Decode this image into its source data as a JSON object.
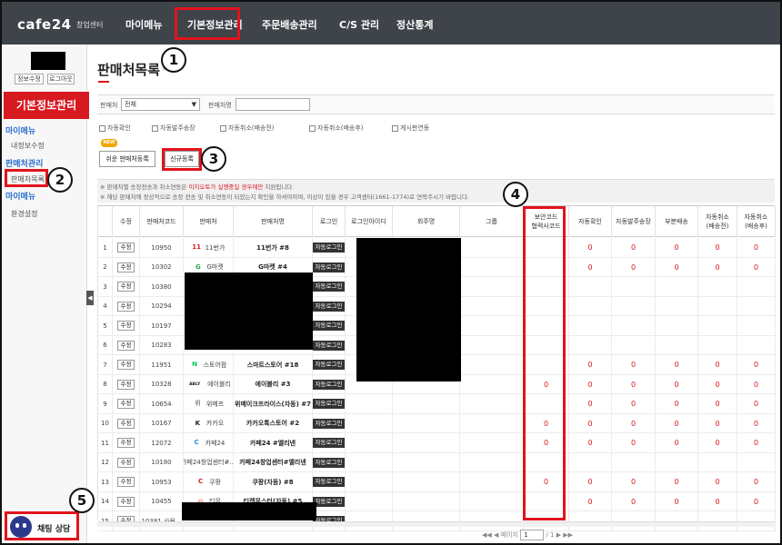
{
  "brand": {
    "logo": "cafe24",
    "sub": "창업센터"
  },
  "nav": [
    "마이메뉴",
    "기본정보관리",
    "주문배송관리",
    "C/S 관리",
    "정산통계"
  ],
  "callouts": [
    "1",
    "2",
    "3",
    "4",
    "5"
  ],
  "sidebar": {
    "buttons": [
      "정보수정",
      "로그아웃"
    ],
    "section_title": "기본정보관리",
    "head1": "마이메뉴",
    "item1": "내정보수정",
    "head2": "판매처관리",
    "item2": "판매처목록",
    "head3": "마이메뉴",
    "item3": "환경설정",
    "toggle": "◀",
    "chat_label": "채팅 상담"
  },
  "page": {
    "title": "판매처목록",
    "title_icon": "★"
  },
  "filter": {
    "label1": "판매처",
    "select1": "전체",
    "label2": "판매처명",
    "input2": ""
  },
  "checkboxes": [
    "자동확인",
    "자동발주송장",
    "자동취소(배송전)",
    "자동취소(배송후)",
    "게시판연동"
  ],
  "new_tag": "NEW",
  "buttons": {
    "easy": "쉬운 판매처등록",
    "new": "신규등록"
  },
  "notes": {
    "n1_pre": "※ 판매처별 송장전송과 취소연동은 ",
    "n1_hl": "이지오토가 실행중일 경우에만",
    "n1_post": " 지원됩니다.",
    "n2": "※ 해당 판매처에 정상적으로 송장 전송 및 취소연동이 되었는지 확인을 하셔야하며, 이상이 있을 경우 고객센터(1661-1774)로 연락주시기 바랍니다."
  },
  "table": {
    "headers": [
      "",
      "수정",
      "판매처코드",
      "판매처",
      "판매처명",
      "로그인",
      "로그인아이디",
      "회주명",
      "그룹",
      "보안코드\n협력사코드",
      "자동확인",
      "자동발주송장",
      "부분배송",
      "자동취소\n(배송전)",
      "자동취소\n(배송후)"
    ],
    "edit_label": "수정",
    "login_label": "자동로그인",
    "zero": "0",
    "rows": [
      {
        "no": "1",
        "code": "10950",
        "logo": "11",
        "logo_color": "#d71920",
        "mall": "11번가",
        "name": "11번가 #8",
        "sec": false
      },
      {
        "no": "2",
        "code": "10302",
        "logo": "G",
        "logo_color": "#2ea44f",
        "mall": "G마켓",
        "name": "G마켓 #4",
        "sec": false
      },
      {
        "no": "3",
        "code": "10380",
        "logo": "",
        "logo_color": "",
        "mall": "",
        "name": "",
        "sec": false
      },
      {
        "no": "4",
        "code": "10294",
        "logo": "",
        "logo_color": "",
        "mall": "",
        "name": "",
        "sec": false
      },
      {
        "no": "5",
        "code": "10197",
        "logo": "",
        "logo_color": "",
        "mall": "",
        "name": "",
        "sec": false
      },
      {
        "no": "6",
        "code": "10283",
        "logo": "",
        "logo_color": "",
        "mall": "",
        "name": "",
        "sec": false
      },
      {
        "no": "7",
        "code": "11951",
        "logo": "N",
        "logo_color": "#03c75a",
        "mall": "스토어팜",
        "name": "스마트스토어 #18",
        "sec": false
      },
      {
        "no": "8",
        "code": "10328",
        "logo": "ABLY",
        "logo_color": "#222222",
        "mall": "에이블리",
        "name": "에이블리 #3",
        "sec": true
      },
      {
        "no": "9",
        "code": "10654",
        "logo": "위",
        "logo_color": "#888888",
        "mall": "위메프",
        "name": "위메이크프라이스(자동) #7",
        "sec": false
      },
      {
        "no": "10",
        "code": "10167",
        "logo": "K",
        "logo_color": "#222222",
        "mall": "카카오",
        "name": "카카오톡스토어 #2",
        "sec": true
      },
      {
        "no": "11",
        "code": "12072",
        "logo": "C",
        "logo_color": "#1e88e5",
        "mall": "카페24",
        "name": "카페24 #엘리넨",
        "sec": true
      },
      {
        "no": "12",
        "code": "10180",
        "logo": "",
        "logo_color": "",
        "mall": "카페24창업센터#...",
        "name": "카페24창업센터#엘리넨",
        "sec": false
      },
      {
        "no": "13",
        "code": "10953",
        "logo": "C",
        "logo_color": "#d71920",
        "mall": "쿠팡",
        "name": "쿠팡(자동) #8",
        "sec": true
      },
      {
        "no": "14",
        "code": "10455",
        "logo": "◎",
        "logo_color": "#e53935",
        "mall": "티몬",
        "name": "티켓몬스터(자동) #5",
        "sec": false
      },
      {
        "no": "15",
        "code": "10381 사용...",
        "logo": "",
        "logo_color": "",
        "mall": "",
        "name": "",
        "sec": false
      }
    ]
  },
  "pager": {
    "prev": "◀◀ ◀",
    "label": "페이지",
    "current": "1",
    "total": "/ 1",
    "next": "▶ ▶▶"
  }
}
